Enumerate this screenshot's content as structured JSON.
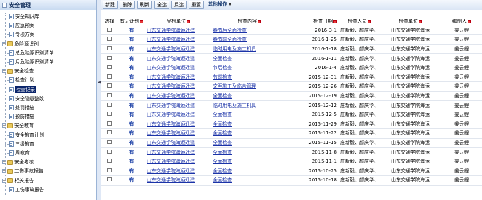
{
  "sidebar": {
    "title": "安全管理",
    "nodes": [
      {
        "label": "安全知识库",
        "depth": 1
      },
      {
        "label": "应急预案",
        "depth": 1
      },
      {
        "label": "专项方案",
        "depth": 1
      },
      {
        "label": "危险源识别",
        "depth": 0
      },
      {
        "label": "总危险源识别清单",
        "depth": 1
      },
      {
        "label": "月危险源识别清单",
        "depth": 1
      },
      {
        "label": "安全检查",
        "depth": 0
      },
      {
        "label": "检查计划",
        "depth": 1
      },
      {
        "label": "检查记录",
        "depth": 1,
        "selected": true
      },
      {
        "label": "安全隐患整改",
        "depth": 1
      },
      {
        "label": "处罚措施",
        "depth": 1
      },
      {
        "label": "预防措施",
        "depth": 1
      },
      {
        "label": "安全教育",
        "depth": 0
      },
      {
        "label": "安全教育计划",
        "depth": 1
      },
      {
        "label": "三级教育",
        "depth": 1
      },
      {
        "label": "周教育",
        "depth": 1
      },
      {
        "label": "安全考核",
        "depth": 0
      },
      {
        "label": "工伤事故报告",
        "depth": 0
      },
      {
        "label": "相关报告",
        "depth": 0
      },
      {
        "label": "工伤事故报告",
        "depth": 1
      }
    ]
  },
  "toolbar": {
    "new": "新建",
    "delete": "删除",
    "refresh": "刷新",
    "select_all": "全选",
    "invert": "反选",
    "reset": "重置",
    "more": "其他操作"
  },
  "table": {
    "headers": {
      "select": "选择",
      "plan": "有无计划",
      "unit": "受检单位",
      "content": "检查内容",
      "date": "检查日期",
      "person": "检查人员",
      "check_unit": "检查单位",
      "owner": "编制人"
    },
    "rows": [
      {
        "plan": "有",
        "unit": "山东交通学院海运迁建",
        "content": "春节后全面检查",
        "date": "2016-3-1",
        "person": "庄新毅、颜庆华、",
        "check_unit": "山东交通学院海运",
        "owner": "姜云鲤"
      },
      {
        "plan": "有",
        "unit": "山东交通学院海运迁建",
        "content": "春节前全面检查",
        "date": "2016-1-25",
        "person": "庄新毅、颜庆华、",
        "check_unit": "山东交通学院海运",
        "owner": "姜云鲤"
      },
      {
        "plan": "有",
        "unit": "山东交通学院海运迁建",
        "content": "临时用电及施工机具",
        "date": "2016-1-18",
        "person": "庄新毅、颜庆华、",
        "check_unit": "山东交通学院海运",
        "owner": "姜云鲤"
      },
      {
        "plan": "有",
        "unit": "山东交通学院海运迁建",
        "content": "全面检查",
        "date": "2016-1-11",
        "person": "庄新毅、颜庆华、",
        "check_unit": "山东交通学院海运",
        "owner": "姜云鲤"
      },
      {
        "plan": "有",
        "unit": "山东交通学院海运迁建",
        "content": "节后检查",
        "date": "2016-1-4",
        "person": "庄新毅、颜庆华、",
        "check_unit": "山东交通学院海运",
        "owner": "姜云鲤"
      },
      {
        "plan": "有",
        "unit": "山东交通学院海运迁建",
        "content": "节前检查",
        "date": "2015-12-31",
        "person": "庄新毅、颜庆华、",
        "check_unit": "山东交通学院海运",
        "owner": "姜云鲤"
      },
      {
        "plan": "有",
        "unit": "山东交通学院海运迁建",
        "content": "文明施工及临舍管理",
        "date": "2015-12-26",
        "person": "庄新毅、颜庆华、",
        "check_unit": "山东交通学院海运",
        "owner": "姜云鲤"
      },
      {
        "plan": "有",
        "unit": "山东交通学院海运迁建",
        "content": "全面检查",
        "date": "2015-12-19",
        "person": "庄新毅、颜庆华、",
        "check_unit": "山东交通学院海运",
        "owner": "姜云鲤"
      },
      {
        "plan": "有",
        "unit": "山东交通学院海运迁建",
        "content": "临时用电及施工机具",
        "date": "2015-12-12",
        "person": "庄新毅、颜庆华、",
        "check_unit": "山东交通学院海运",
        "owner": "姜云鲤"
      },
      {
        "plan": "有",
        "unit": "山东交通学院海运迁建",
        "content": "全面检查",
        "date": "2015-12-5",
        "person": "庄新毅、颜庆华、",
        "check_unit": "山东交通学院海运",
        "owner": "姜云鲤"
      },
      {
        "plan": "有",
        "unit": "山东交通学院海运迁建",
        "content": "全面检查",
        "date": "2015-11-29",
        "person": "庄新毅、颜庆华、",
        "check_unit": "山东交通学院海运",
        "owner": "姜云鲤"
      },
      {
        "plan": "有",
        "unit": "山东交通学院海运迁建",
        "content": "全面检查",
        "date": "2015-11-22",
        "person": "庄新毅、颜庆华、",
        "check_unit": "山东交通学院海运",
        "owner": "姜云鲤"
      },
      {
        "plan": "有",
        "unit": "山东交通学院海运迁建",
        "content": "全面检查",
        "date": "2015-11-15",
        "person": "庄新毅、颜庆华、",
        "check_unit": "山东交通学院海运",
        "owner": "姜云鲤"
      },
      {
        "plan": "有",
        "unit": "山东交通学院海运迁建",
        "content": "全面检查",
        "date": "2015-11-8",
        "person": "庄新毅、颜庆华、",
        "check_unit": "山东交通学院海运",
        "owner": "姜云鲤"
      },
      {
        "plan": "有",
        "unit": "山东交通学院海运迁建",
        "content": "全面检查",
        "date": "2015-11-1",
        "person": "庄新毅、颜庆华、",
        "check_unit": "山东交通学院海运",
        "owner": "姜云鲤"
      },
      {
        "plan": "有",
        "unit": "山东交通学院海运迁建",
        "content": "全面检查",
        "date": "2015-10-25",
        "person": "庄新毅、颜庆华、",
        "check_unit": "山东交通学院海运",
        "owner": "姜云鲤"
      },
      {
        "plan": "有",
        "unit": "山东交通学院海运迁建",
        "content": "全面检查",
        "date": "2015-10-18",
        "person": "庄新毅、颜庆华、",
        "check_unit": "山东交通学院海运",
        "owner": "姜云鲤"
      }
    ]
  },
  "colors": {
    "header_bg": "#c9dbf1",
    "selected_bg": "#0a246a",
    "link": "#1b33a8",
    "flag": "#e63a3a"
  }
}
